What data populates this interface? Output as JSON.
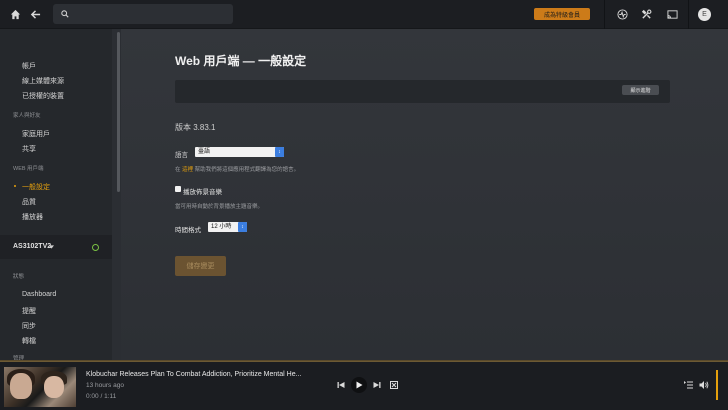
{
  "topbar": {
    "search_placeholder": "",
    "premium_label": "成為特級會員",
    "avatar_initial": "E"
  },
  "sidebar": {
    "items_account": [
      {
        "label": "帳戶"
      },
      {
        "label": "線上媒體來源"
      },
      {
        "label": "已授權的裝置"
      }
    ],
    "heading_family": "家人與好友",
    "items_family": [
      {
        "label": "家庭用戶"
      },
      {
        "label": "共享"
      }
    ],
    "heading_web": "WEB 用戶端",
    "items_web": [
      {
        "label": "一般設定",
        "active": true
      },
      {
        "label": "品質"
      },
      {
        "label": "播放器"
      }
    ],
    "server_name": "AS3102TV2",
    "heading_status": "狀態",
    "items_status": [
      {
        "label": "Dashboard"
      },
      {
        "label": "提醒"
      },
      {
        "label": "同步"
      },
      {
        "label": "轉檔"
      }
    ],
    "heading_partial": "管理"
  },
  "main": {
    "title": "Web 用戶端 — 一般設定",
    "advanced_button": "顯示進階",
    "version": "版本 3.83.1",
    "language": {
      "label": "語言",
      "value": "臺語",
      "help_prefix": "在 ",
      "help_link": "這裡",
      "help_suffix": " 幫助我們將這個應用程式翻譯為您的語言。"
    },
    "theme_music": {
      "label": "播放佈景音樂",
      "checked": false,
      "help": "當可用時自動於背景播放主題音樂。"
    },
    "time_format": {
      "label": "時間格式",
      "value": "12 小時"
    },
    "save_button": "儲存變更"
  },
  "player": {
    "title": "Klobuchar Releases Plan To Combat Addiction, Prioritize Mental He...",
    "ago": "13 hours ago",
    "position": "0:00 / 1:11"
  },
  "colors": {
    "accent": "#e5a00d",
    "topbar": "#1c1e22",
    "sidebar": "#25282c",
    "select_arrow": "#3b7ee0",
    "server_online": "#7ac143"
  }
}
